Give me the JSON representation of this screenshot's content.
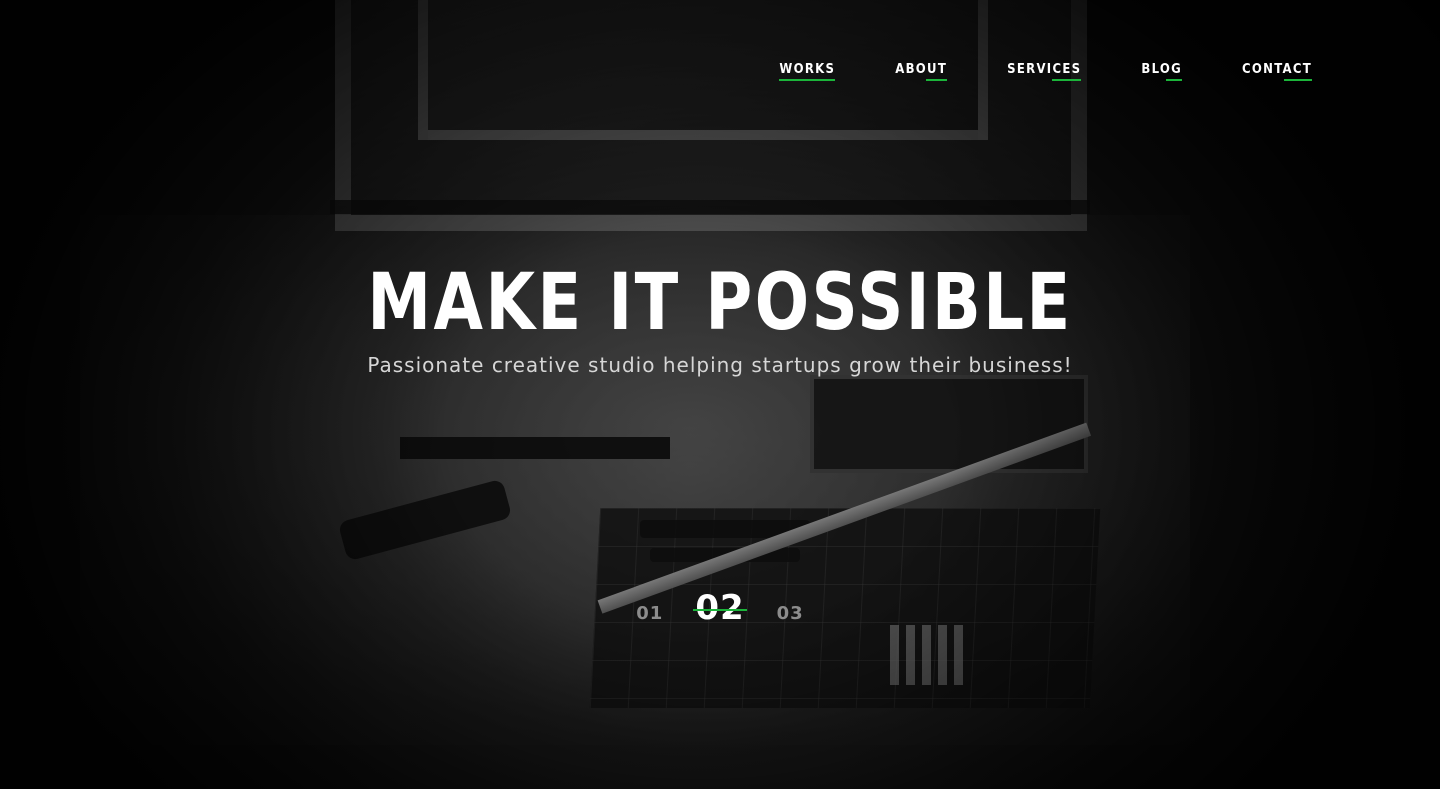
{
  "nav": {
    "items": [
      {
        "label": "WORKS",
        "active": true
      },
      {
        "label": "ABOUT",
        "active": false
      },
      {
        "label": "SERVICES",
        "active": false
      },
      {
        "label": "BLOG",
        "active": false
      },
      {
        "label": "CONTACT",
        "active": false
      }
    ]
  },
  "hero": {
    "title": "MAKE IT POSSIBLE",
    "subtitle": "Passionate creative studio helping startups grow their business!"
  },
  "slider": {
    "items": [
      "01",
      "02",
      "03"
    ],
    "active_index": 1
  },
  "colors": {
    "accent": "#1bb53a",
    "text": "#ffffff",
    "muted": "#8c8c8c",
    "background": "#0b0b0b"
  }
}
